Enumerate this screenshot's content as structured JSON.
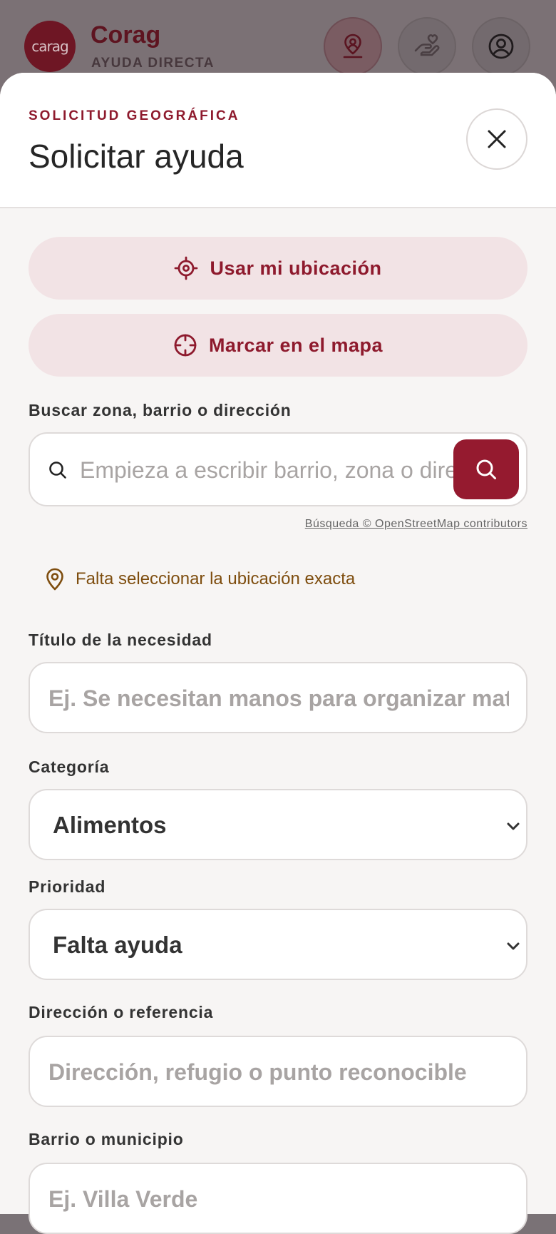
{
  "header": {
    "logo_text": "carag",
    "brand": "Corag",
    "subtitle": "AYUDA DIRECTA",
    "icons": [
      "map-pin-person-icon",
      "helping-hand-icon",
      "user-circle-icon"
    ]
  },
  "sheet": {
    "eyebrow": "SOLICITUD GEOGRÁFICA",
    "title": "Solicitar ayuda",
    "use_location": "Usar mi ubicación",
    "mark_on_map": "Marcar en el mapa",
    "search_label": "Buscar zona, barrio o dirección",
    "search_placeholder": "Empieza a escribir barrio, zona o dirección",
    "attribution": "Búsqueda © OpenStreetMap contributors",
    "location_warning": "Falta seleccionar la ubicación exacta",
    "title_label": "Título de la necesidad",
    "title_placeholder": "Ej. Se necesitan manos para organizar material",
    "category_label": "Categoría",
    "category_value": "Alimentos",
    "priority_label": "Prioridad",
    "priority_value": "Falta ayuda",
    "address_label": "Dirección o referencia",
    "address_placeholder": "Dirección, refugio o punto reconocible",
    "municipality_label": "Barrio o municipio",
    "municipality_placeholder": "Ej. Villa Verde"
  },
  "colors": {
    "accent": "#951a2f",
    "accent_soft": "#f2e3e5",
    "warning": "#7e4d0e",
    "overlay": "#7a7276"
  }
}
